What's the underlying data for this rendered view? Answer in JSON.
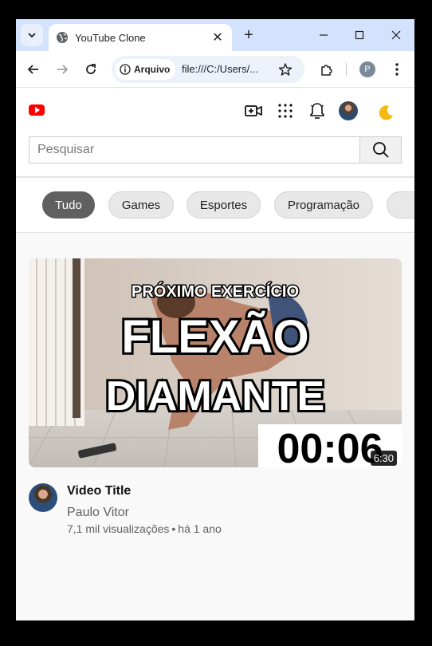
{
  "browser": {
    "tab_title": "YouTube Clone",
    "site_info_label": "Arquivo",
    "url": "file:///C:/Users/...",
    "profile_initial": "P"
  },
  "header": {
    "icons": [
      "youtube-logo-icon",
      "create-video-icon",
      "apps-grid-icon",
      "notifications-bell-icon",
      "user-avatar",
      "dark-mode-moon-icon"
    ]
  },
  "search": {
    "placeholder": "Pesquisar"
  },
  "categories": [
    {
      "label": "Tudo",
      "active": true
    },
    {
      "label": "Games",
      "active": false
    },
    {
      "label": "Esportes",
      "active": false
    },
    {
      "label": "Programação",
      "active": false
    }
  ],
  "video": {
    "thumbnail": {
      "line1": "PRÓXIMO EXERCÍCIO",
      "line2": "FLEXÃO",
      "line3": "DIAMANTE",
      "timer": "00:06"
    },
    "duration": "6:30",
    "title": "Video Title",
    "channel": "Paulo Vitor",
    "views": "7,1 mil visualizações",
    "age": "há 1 ano",
    "separator": "•"
  },
  "colors": {
    "titlebar": "#d3e3fd",
    "yt_red": "#ff0000",
    "chip_active": "#606060",
    "chip_inactive": "#e8e8e8",
    "moon": "#f5b915"
  }
}
